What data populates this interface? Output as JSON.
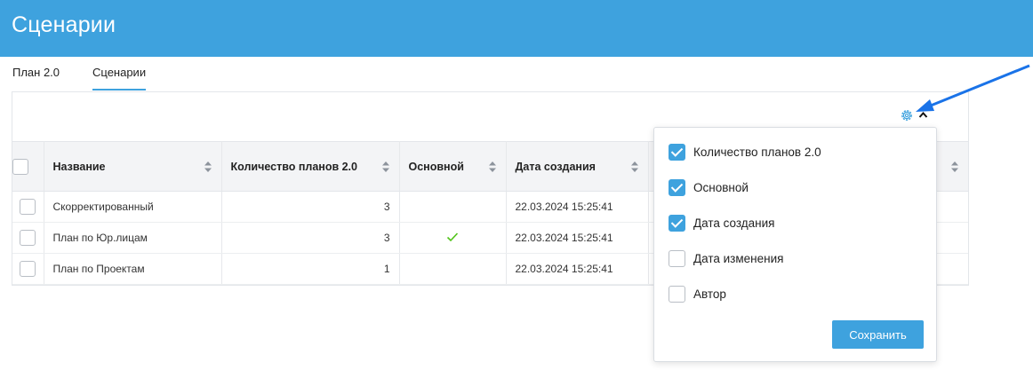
{
  "header": {
    "title": "Сценарии"
  },
  "tabs": [
    {
      "label": "План 2.0",
      "active": false
    },
    {
      "label": "Сценарии",
      "active": true
    }
  ],
  "table": {
    "columns": [
      "Название",
      "Количество планов 2.0",
      "Основной",
      "Дата создания",
      ""
    ],
    "rows": [
      {
        "name": "Скорректированный",
        "count": "3",
        "main": false,
        "created": "22.03.2024 15:25:41"
      },
      {
        "name": "План по Юр.лицам",
        "count": "3",
        "main": true,
        "created": "22.03.2024 15:25:41"
      },
      {
        "name": "План по Проектам",
        "count": "1",
        "main": false,
        "created": "22.03.2024 15:25:41"
      }
    ]
  },
  "column_settings": {
    "options": [
      {
        "label": "Количество планов 2.0",
        "checked": true
      },
      {
        "label": "Основной",
        "checked": true
      },
      {
        "label": "Дата создания",
        "checked": true
      },
      {
        "label": "Дата изменения",
        "checked": false
      },
      {
        "label": "Автор",
        "checked": false
      }
    ],
    "save_label": "Сохранить"
  },
  "icons": {
    "settings": "gear-icon",
    "collapse": "chevron-up-icon",
    "sort": "sort-icon",
    "check": "checkmark-icon",
    "annotation": "arrow-icon"
  },
  "colors": {
    "accent": "#3ea2de",
    "check_green": "#52c41a",
    "annotation_arrow": "#1a73e8"
  }
}
